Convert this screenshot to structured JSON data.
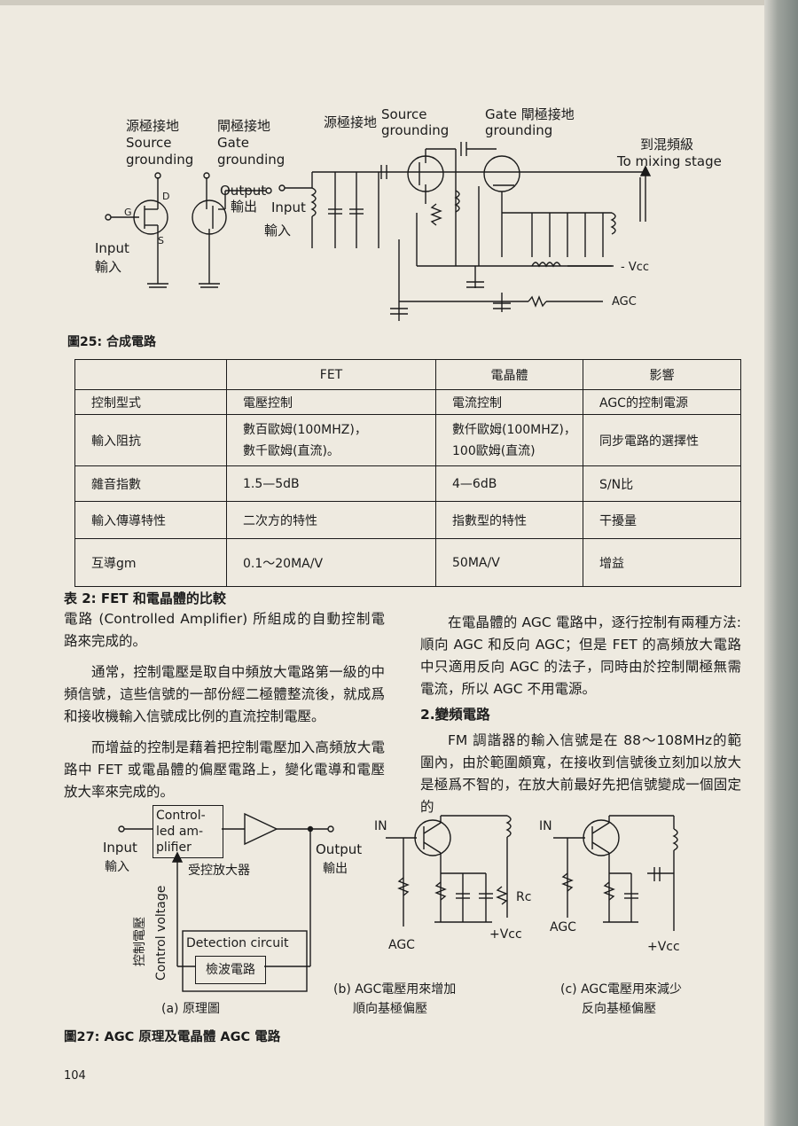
{
  "fig25": {
    "labels": {
      "src_gnd_cn": "源極接地",
      "src_gnd_en1": "Source",
      "src_gnd_en2": "grounding",
      "gate_gnd_cn": "閘極接地",
      "gate_gnd_en1": "Gate",
      "gate_gnd_en2": "grounding",
      "output_en": "Output",
      "output_cn": "輸出",
      "input_en": "Input",
      "input_cn": "輸入",
      "src_gnd2_cn": "源極接地",
      "src_gnd2_en1": "Source",
      "src_gnd2_en2": "grounding",
      "gate_gnd2": "Gate 閘極接地",
      "gate_gnd2_en": "grounding",
      "mix_cn": "到混頻級",
      "mix_en": "To mixing stage",
      "input2_en": "Input",
      "input2_cn": "輸入",
      "vcc": "- Vcc",
      "agc": "AGC",
      "pin_g": "G",
      "pin_d": "D",
      "pin_s": "S"
    },
    "caption": "圖25: 合成電路"
  },
  "table2": {
    "headers": [
      "",
      "FET",
      "電晶體",
      "影響"
    ],
    "rows": [
      [
        "控制型式",
        "電壓控制",
        "電流控制",
        "AGC的控制電源"
      ],
      [
        "輸入阻抗",
        "數百歐姆(100MHZ)，\n數千歐姆(直流)。",
        "數仟歐姆(100MHZ)，\n100歐姆(直流)",
        "同步電路的選擇性"
      ],
      [
        "雜音指數",
        "1.5—5dB",
        "4—6dB",
        "S/N比"
      ],
      [
        "輸入傳導特性",
        "二次方的特性",
        "指數型的特性",
        "干擾量"
      ],
      [
        "互導gm",
        "0.1～20MA/V",
        "50MA/V",
        "增益"
      ]
    ],
    "caption": "表 2: FET 和電晶體的比較"
  },
  "text_left": {
    "p1": "電路 (Controlled Amplifier) 所組成的自動控制電路來完成的。",
    "p2": "通常，控制電壓是取自中頻放大電路第一級的中頻信號，這些信號的一部份經二極體整流後，就成爲和接收機輸入信號成比例的直流控制電壓。",
    "p3": "而增益的控制是藉着把控制電壓加入高頻放大電路中 FET 或電晶體的偏壓電路上，變化電導和電壓放大率來完成的。"
  },
  "text_right": {
    "p1": "在電晶體的 AGC 電路中，逐行控制有兩種方法: 順向 AGC 和反向 AGC；但是 FET 的高頻放大電路中只適用反向 AGC 的法子，同時由於控制閘極無需電流，所以 AGC 不用電源。",
    "h2": "2.變頻電路",
    "p2": "FM 調諧器的輸入信號是在 88～108MHz的範圍內，由於範圍頗寬，在接收到信號後立刻加以放大是極爲不智的，在放大前最好先把信號變成一個固定的"
  },
  "fig27": {
    "a": {
      "block1a": "Control-",
      "block1b": "led am-",
      "block1c": "plifier",
      "block1_cn": "受控放大器",
      "input_en": "Input",
      "input_cn": "輸入",
      "output_en": "Output",
      "output_cn": "輸出",
      "control_cn": "控制電壓",
      "control_en": "Control voltage",
      "detect_en": "Detection circuit",
      "detect_cn": "檢波電路",
      "sub": "(a) 原理圖"
    },
    "b": {
      "in": "IN",
      "agc": "AGC",
      "vcc": "+Vcc",
      "rc": "Rc",
      "sub1": "(b) AGC電壓用來增加",
      "sub2": "順向基極偏壓"
    },
    "c": {
      "in": "IN",
      "agc": "AGC",
      "vcc": "+Vcc",
      "sub1": "(c) AGC電壓用來減少",
      "sub2": "反向基極偏壓"
    },
    "caption": "圖27: AGC 原理及電晶體 AGC 電路"
  },
  "page_number": "104"
}
